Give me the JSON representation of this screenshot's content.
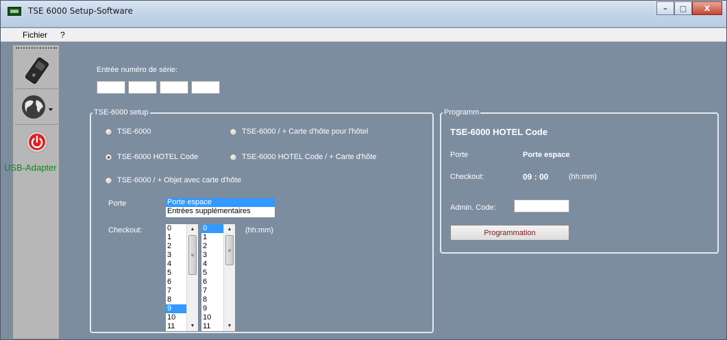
{
  "window": {
    "title": "TSE 6000 Setup-Software",
    "controls": {
      "minimize": "–",
      "maximize": "□",
      "close": "X"
    }
  },
  "menu": {
    "items": [
      "Fichier",
      "?"
    ]
  },
  "sidebar": {
    "buttons": [
      {
        "icon": "card-reader-icon"
      },
      {
        "icon": "globe-language-icon"
      },
      {
        "icon": "power-icon"
      }
    ],
    "usb_label": "USB-Adapter",
    "colors": {
      "usb_label": "#0b8a1b",
      "power": "#e02020"
    }
  },
  "serial": {
    "label": "Entrée numéro de série:",
    "fields": [
      "",
      "",
      "",
      ""
    ]
  },
  "setup": {
    "title": "TSE-6000 setup",
    "options": [
      {
        "label": "TSE-6000",
        "selected": false
      },
      {
        "label": "TSE-6000 / + Carte d'hôte pour l'hôtel",
        "selected": false
      },
      {
        "label": "TSE-6000 HOTEL Code",
        "selected": true
      },
      {
        "label": "TSE-6000 HOTEL Code / + Carte d'hôte",
        "selected": false
      },
      {
        "label": "TSE-6000 / + Objet avec carte d'hôte",
        "selected": false
      }
    ],
    "porte": {
      "label": "Porte",
      "items": [
        "Porte espace",
        "Entrées supplémentaires"
      ],
      "selected": "Porte espace"
    },
    "checkout": {
      "label": "Checkout:",
      "hours": [
        "0",
        "1",
        "2",
        "3",
        "4",
        "5",
        "6",
        "7",
        "8",
        "9",
        "10",
        "11"
      ],
      "selected_hour": "9",
      "minutes": [
        "0",
        "1",
        "2",
        "3",
        "4",
        "5",
        "6",
        "7",
        "8",
        "9",
        "10",
        "11"
      ],
      "selected_minute": "0",
      "unit": "(hh:mm)"
    }
  },
  "programm": {
    "title": "Programm",
    "heading": "TSE-6000 HOTEL Code",
    "porte_label": "Porte",
    "porte_value": "Porte espace",
    "checkout_label": "Checkout:",
    "checkout_value": "09 : 00",
    "checkout_unit": "(hh:mm)",
    "admin_label": "Admin. Code:",
    "admin_value": "",
    "button": "Programmation"
  }
}
